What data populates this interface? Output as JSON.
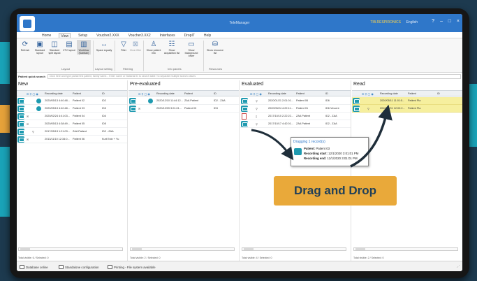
{
  "window": {
    "title": "TeleManager",
    "user": "TIB.RESPIRONICS",
    "language": "English"
  },
  "ribbon": {
    "tabs": [
      "Home",
      "View",
      "Setup",
      "Voucher2.XXX",
      "Voucher3.XX2",
      "Interfaces",
      "DropIT",
      "Help"
    ],
    "buttons": [
      {
        "label": "Refresh"
      },
      {
        "label": "Standard layout"
      },
      {
        "label": "Standard split layout"
      },
      {
        "label": "ZTV layout"
      },
      {
        "label": "Workflow (Kanban)"
      },
      {
        "label": "Space equally"
      },
      {
        "label": "Filter"
      },
      {
        "label": "Clear filter"
      },
      {
        "label": "Show patient info"
      },
      {
        "label": "Show acquisition list"
      },
      {
        "label": "Show background lower"
      },
      {
        "label": "Show resource list"
      }
    ],
    "groups": [
      "Layout",
      "Layout setting",
      "Filtering",
      "Info panels",
      "Resources"
    ]
  },
  "quick_search": {
    "label": "Patient quick search",
    "placeholder": "Click here and type partial first patient, family name... Enter name or National ID to search table / to separate multiple search values"
  },
  "columns": [
    {
      "title": "New",
      "headers": [
        "Recording date",
        "Patient",
        "ID"
      ],
      "rows": [
        {
          "date": "2020/05/13 4:40:48...",
          "patient": "Patient 02",
          "id": "ID2",
          "hl": false
        },
        {
          "date": "2020/05/13 4:40:48...",
          "patient": "Patient 03",
          "id": "ID3",
          "hl": false
        },
        {
          "date": "2020/02/24 4:41:03...",
          "patient": "Patient 04",
          "id": "ID4",
          "hl": false
        },
        {
          "date": "2020/05/13 4:38:49...",
          "patient": "Patient 05",
          "id": "ID5",
          "hl": false
        },
        {
          "date": "2017/05/13 1:21:03...",
          "patient": "ZAA Patient",
          "id": "ID2 - ZAA",
          "hl": false
        },
        {
          "date": "2013/11/10 12:34:0...",
          "patient": "Patient 06",
          "id": "Kurt Enin + Yu",
          "hl": false
        }
      ],
      "footer": "Total visible: 6 / Selected: 0"
    },
    {
      "title": "Pre-evaluated",
      "headers": [
        "Recording date",
        "Patient",
        "ID"
      ],
      "rows": [
        {
          "date": "2020/12/10 11:44:12...",
          "patient": "ZAA Patient",
          "id": "ID2 - ZAA",
          "hl": false
        },
        {
          "date": "2020/12/09 3:01:01...",
          "patient": "Patient 03",
          "id": "ID3",
          "hl": false
        }
      ],
      "footer": "Total visible: 2 / Selected: 0"
    },
    {
      "title": "Evaluated",
      "headers": [
        "Recording date",
        "Patient",
        "ID"
      ],
      "rows": [
        {
          "date": "2020/01/21 2:01:01...",
          "patient": "Patient 06",
          "id": "ID6",
          "hl": false
        },
        {
          "date": "2020/05/24 4:22:11...",
          "patient": "Patient 01",
          "id": "ID6 Vincent",
          "hl": false
        },
        {
          "date": "2017/10/10 2:22:22...",
          "patient": "ZAA Patient",
          "id": "ID2 - ZAA",
          "hl": false
        },
        {
          "date": "2017/10/17 4:42:01...",
          "patient": "ZAA Patient",
          "id": "ID2 - ZAA",
          "hl": false
        }
      ],
      "footer": "Total visible: 4 / Selected: 0"
    },
    {
      "title": "Read",
      "headers": [
        "Recording date",
        "Patient",
        "ID"
      ],
      "rows": [
        {
          "date": "2020/05/11 11:01:5...",
          "patient": "Patient Pla",
          "id": "",
          "hl": true
        },
        {
          "date": "2010/11/01 12:00:2...",
          "patient": "Patient Pla",
          "id": "",
          "hl": true
        }
      ],
      "footer": "Total visible: 2 / Selected: 0"
    }
  ],
  "drag_tooltip": {
    "title": "Dragging 1 record(s)",
    "patient_label": "Patient:",
    "patient": "Patient 03",
    "start_label": "Recording start:",
    "start": "12/1/2020 3:01:01 PM",
    "end_label": "Recording end:",
    "end": "12/1/2020 3:01:01 PM"
  },
  "banner": "Drag and Drop",
  "statusbar": {
    "items": [
      "Database online",
      "Standalone configuration",
      "Printing - File system available"
    ]
  },
  "colors": {
    "accent": "#2f77c9",
    "highlight": "#f6ef9e",
    "banner": "#e9a93a",
    "state_icon": "#1e9ab0"
  }
}
